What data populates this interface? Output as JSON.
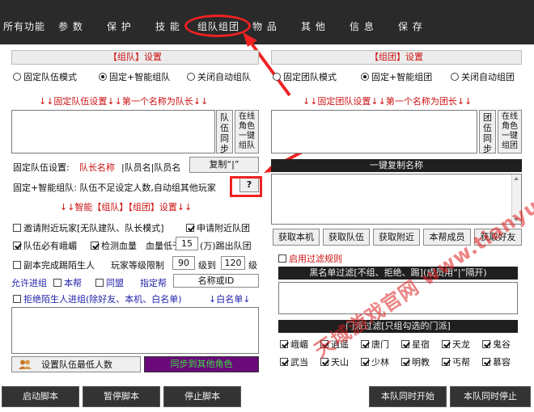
{
  "menu": {
    "items": [
      "所有功能",
      "参 数",
      "保 护",
      "技 能",
      "组队组团",
      "物 品",
      "其 他",
      "信 息",
      "保 存"
    ]
  },
  "party": {
    "header": "【组队】设置",
    "modes": [
      "固定队伍模式",
      "固定+智能组队",
      "关闭自动组队"
    ],
    "selected_mode": 1,
    "list_title": "↓↓固定队伍设置↓↓第一个名称为队长↓↓",
    "sync_btn": "队伍同步",
    "onekey_btn": "在线角色一键组队",
    "fixed_label": "固定队伍设置:",
    "leader_label": "队长名称",
    "members_label": "|队员名|队员名",
    "copy_btn": "复制“|”",
    "smart_label": "固定+智能组队: 队伍不足设定人数,自动组其他玩家",
    "help_btn": "?",
    "smart_title": "↓↓智能【组队】【组团】设置↓↓"
  },
  "options": {
    "invite_nearby": "邀请附近玩家[无队建队、队长模式]",
    "invite_nearby_checked": false,
    "apply_nearby": "申请附近队团",
    "apply_nearby_checked": true,
    "need_emei": "队伍必有峨嵋",
    "need_emei_checked": true,
    "check_hp": "检测血量",
    "check_hp_checked": true,
    "hp_below": "血量低于",
    "hp_value": "15",
    "hp_unit": "(万)踢出队团",
    "kick_stranger": "副本完成踢陌生人",
    "kick_stranger_checked": false,
    "level_limit": "玩家等级限制",
    "level_min": "90",
    "level_to": "级到",
    "level_max": "120",
    "level_unit": "级",
    "allow_join": "允许进组",
    "our_guild": "本帮",
    "our_guild_checked": false,
    "ally_guild": "同盟",
    "ally_guild_checked": false,
    "designated_guild": "指定帮",
    "guild_name_value": "名称或ID",
    "refuse_stranger": "拒绝陌生人进组(除好友、本机、白名单)",
    "refuse_stranger_checked": false,
    "whitelist": "↓白名单↓",
    "min_members_btn": "设置队伍最低人数",
    "sync_other_btn": "同步到其他角色"
  },
  "team": {
    "header": "【组团】设置",
    "modes": [
      "固定团队模式",
      "固定+智能组团",
      "关闭自动组团"
    ],
    "selected_mode": 1,
    "list_title": "↓↓固定团队设置↓↓第一个名称为团长↓↓",
    "sync_btn": "团伍同步",
    "onekey_btn": "在线角色一键组团",
    "copy_names_title": "一键复制名称",
    "action_buttons": [
      "获取本机",
      "获取队伍",
      "获取附近",
      "本帮成员",
      "获取好友"
    ],
    "filter_label": "启用过滤规则",
    "filter_checked": false,
    "blacklist_title": "黑名单过滤[不组、拒绝、踢](成员用“|”隔开)",
    "sect_title": "门派过滤[只组勾选的门派]",
    "sects": [
      {
        "name": "峨嵋",
        "checked": true
      },
      {
        "name": "逍遥",
        "checked": true
      },
      {
        "name": "唐门",
        "checked": true
      },
      {
        "name": "星宿",
        "checked": true
      },
      {
        "name": "天龙",
        "checked": true
      },
      {
        "name": "鬼谷",
        "checked": true
      },
      {
        "name": "武当",
        "checked": true
      },
      {
        "name": "天山",
        "checked": true
      },
      {
        "name": "少林",
        "checked": true
      },
      {
        "name": "明教",
        "checked": true
      },
      {
        "name": "丐帮",
        "checked": true
      },
      {
        "name": "慕容",
        "checked": true
      }
    ]
  },
  "bottom": {
    "start": "启动脚本",
    "pause": "暂停脚本",
    "stop": "停止脚本",
    "sync_start": "本队同时开始",
    "sync_stop": "本队同时停止"
  },
  "watermark": "天域游戏官网 www.tianyu...",
  "colors": {
    "accent_red": "#cc1111",
    "menubar": "#2a2a2a",
    "annotation": "#ee2222"
  }
}
